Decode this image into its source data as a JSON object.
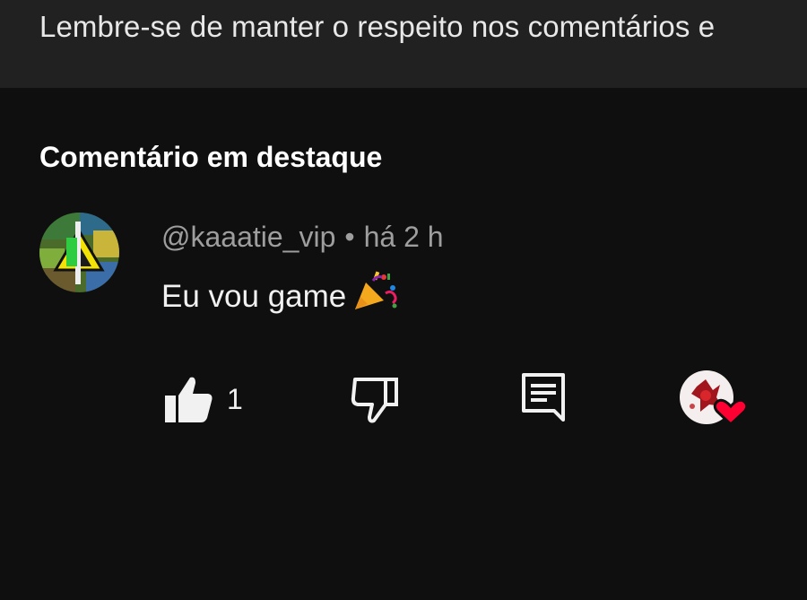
{
  "notice": {
    "text": "Lembre-se de manter o respeito nos comentários e"
  },
  "section": {
    "title": "Comentário em destaque"
  },
  "comment": {
    "author": "@kaaatie_vip",
    "separator": "•",
    "time": "há 2 h",
    "text": "Eu vou game",
    "emoji": "party-popper-icon",
    "likes": "1"
  },
  "actions": {
    "like_icon": "thumbs-up-icon",
    "dislike_icon": "thumbs-down-icon",
    "reply_icon": "comment-reply-icon",
    "creator_heart_icon": "creator-heart-icon"
  },
  "colors": {
    "background": "#0f0f0f",
    "notice_background": "#212121",
    "secondary_text": "#9e9e9e",
    "heart": "#ff0033"
  }
}
